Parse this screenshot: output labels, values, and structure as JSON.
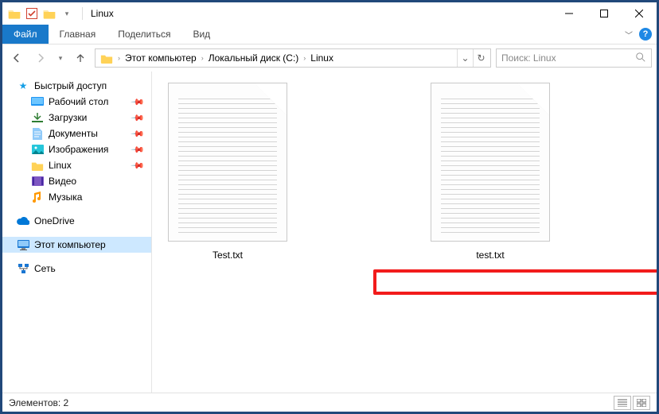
{
  "window": {
    "title": "Linux"
  },
  "ribbon": {
    "file": "Файл",
    "tabs": [
      "Главная",
      "Поделиться",
      "Вид"
    ]
  },
  "breadcrumbs": {
    "items": [
      "Этот компьютер",
      "Локальный диск (C:)",
      "Linux"
    ]
  },
  "search": {
    "placeholder": "Поиск: Linux"
  },
  "sidebar": {
    "quick_access": "Быстрый доступ",
    "quick_items": [
      {
        "label": "Рабочий стол",
        "pinned": true,
        "icon": "desktop"
      },
      {
        "label": "Загрузки",
        "pinned": true,
        "icon": "downloads"
      },
      {
        "label": "Документы",
        "pinned": true,
        "icon": "documents"
      },
      {
        "label": "Изображения",
        "pinned": true,
        "icon": "pictures"
      },
      {
        "label": "Linux",
        "pinned": true,
        "icon": "folder"
      },
      {
        "label": "Видео",
        "pinned": false,
        "icon": "videos"
      },
      {
        "label": "Музыка",
        "pinned": false,
        "icon": "music"
      }
    ],
    "onedrive": "OneDrive",
    "this_pc": "Этот компьютер",
    "network": "Сеть"
  },
  "files": [
    {
      "name": "Test.txt"
    },
    {
      "name": "test.txt"
    }
  ],
  "status": {
    "elements_label": "Элементов: 2"
  }
}
